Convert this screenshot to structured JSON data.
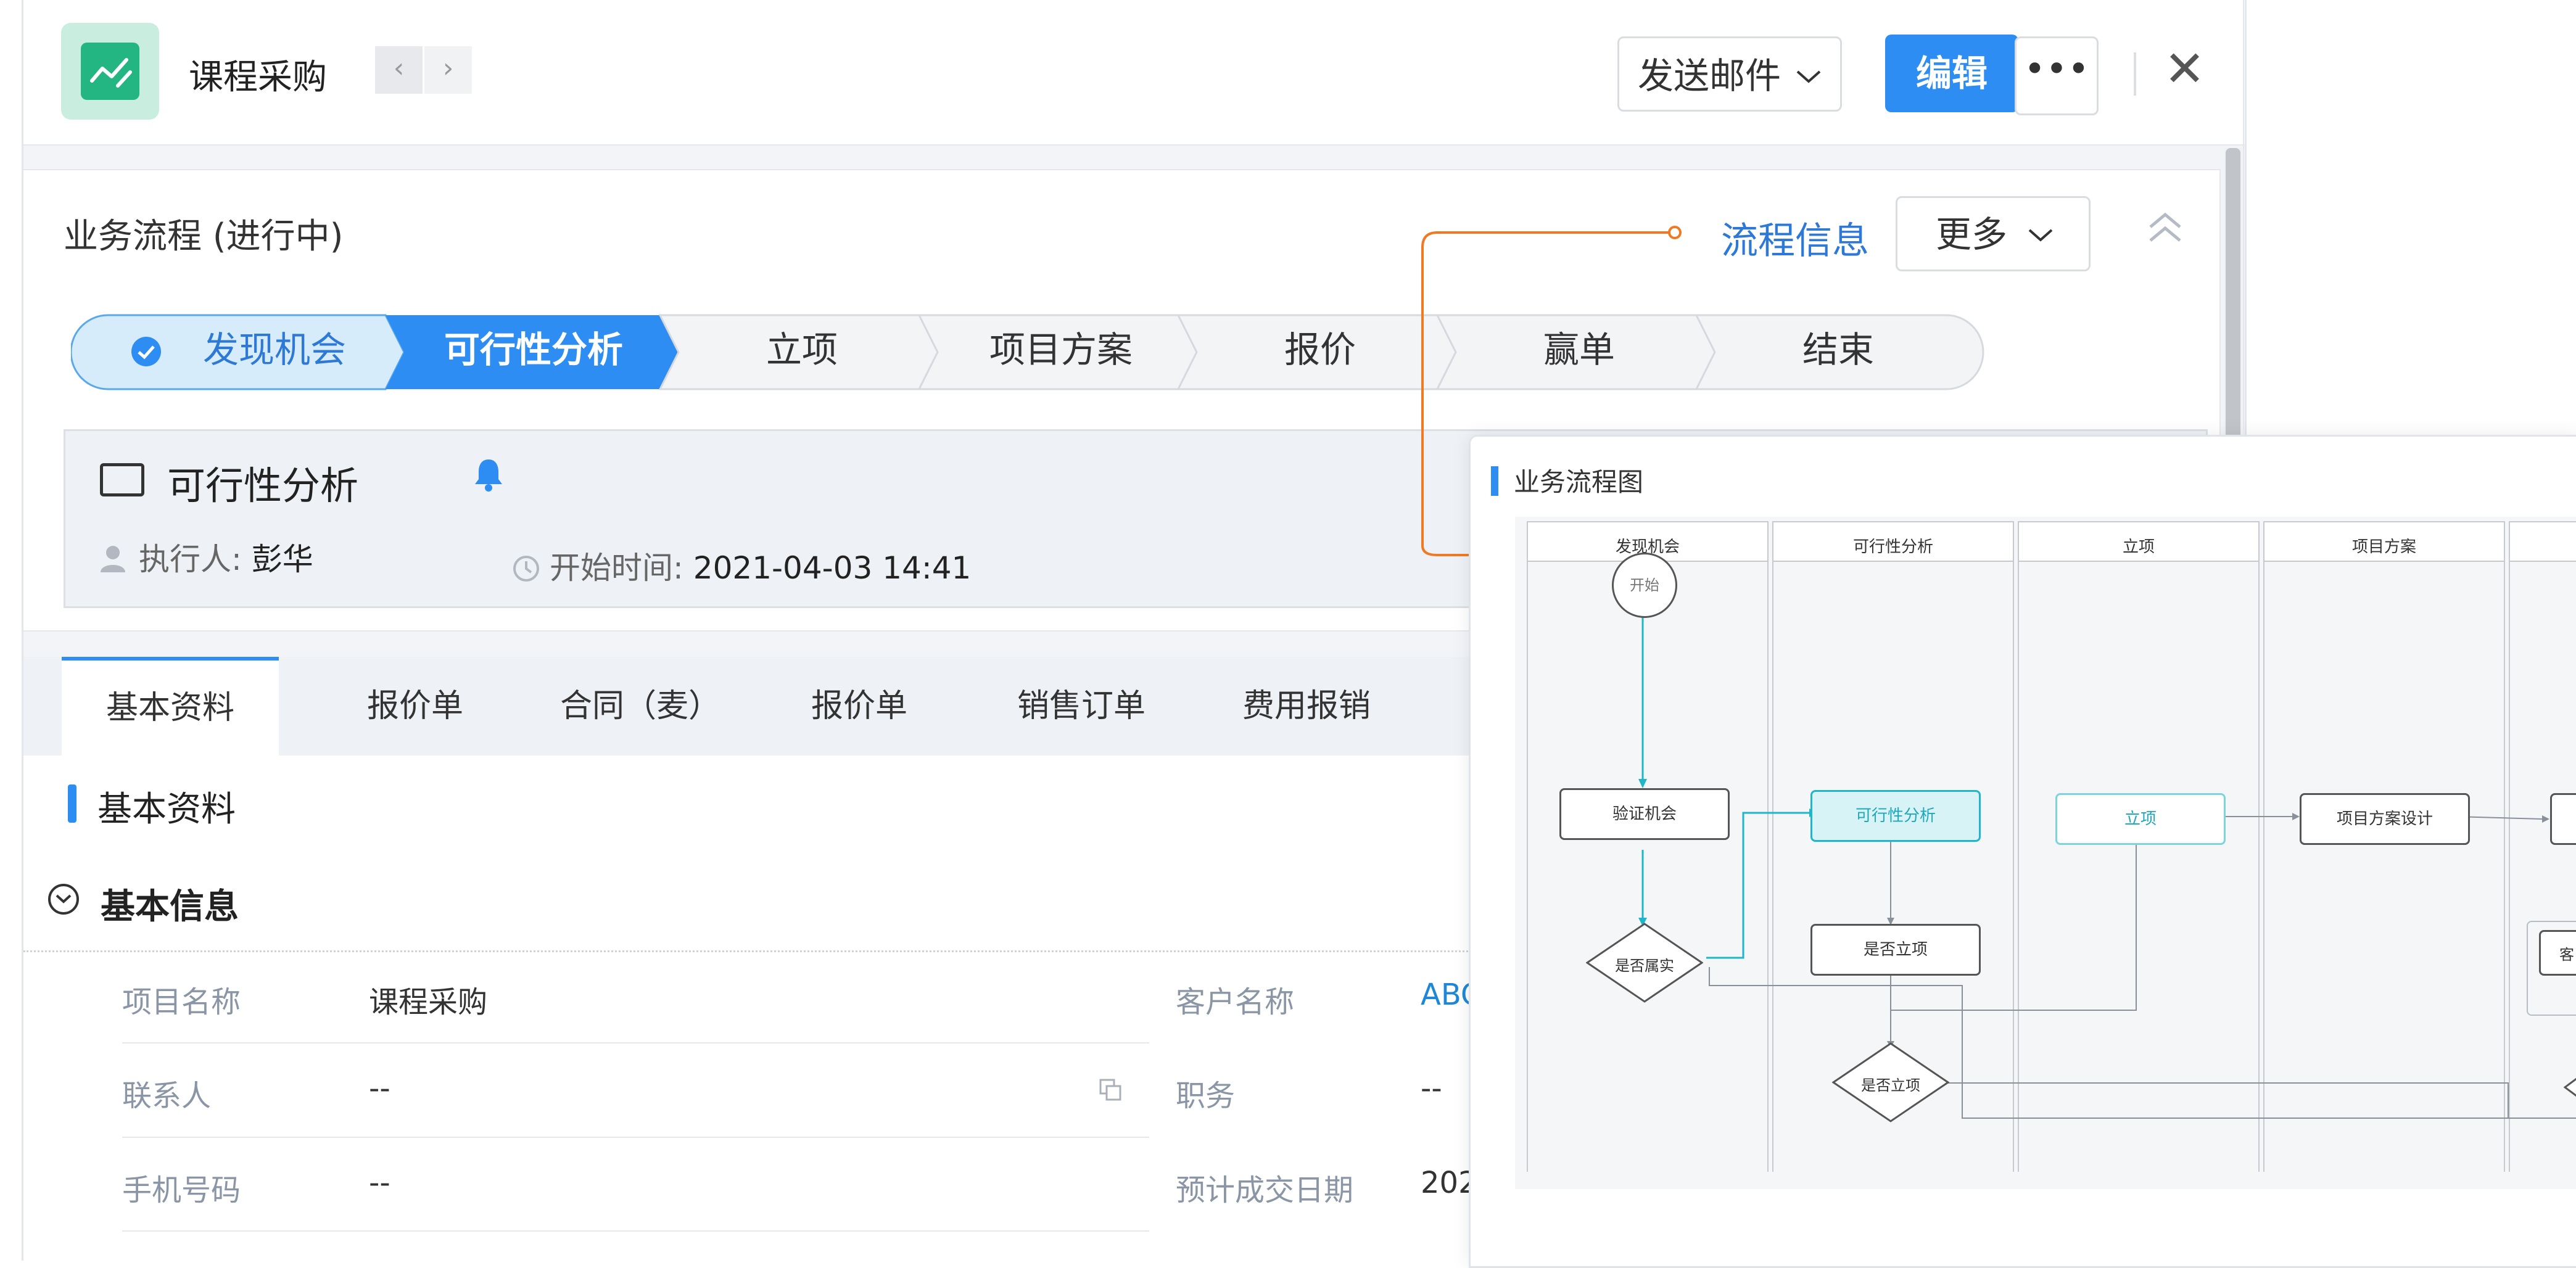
{
  "header": {
    "title": "课程采购",
    "prev_icon": "chevron-left-icon",
    "next_icon": "chevron-right-icon",
    "send_mail_label": "发送邮件",
    "edit_label": "编辑",
    "more_icon": "ellipsis-icon",
    "close_icon": "close-icon"
  },
  "process": {
    "title": "业务流程 (进行中)",
    "flow_info_label": "流程信息",
    "more_label": "更多",
    "stages": [
      {
        "label": "发现机会",
        "state": "done"
      },
      {
        "label": "可行性分析",
        "state": "active"
      },
      {
        "label": "立项",
        "state": "todo"
      },
      {
        "label": "项目方案",
        "state": "todo"
      },
      {
        "label": "报价",
        "state": "todo"
      },
      {
        "label": "赢单",
        "state": "todo"
      },
      {
        "label": "结束",
        "state": "todo"
      }
    ],
    "task": {
      "name": "可行性分析",
      "executor_label": "执行人:",
      "executor": "彭华",
      "start_label": "开始时间:",
      "start_time": "2021-04-03 14:41"
    }
  },
  "tabs": [
    "基本资料",
    "报价单",
    "合同（麦）",
    "报价单",
    "销售订单",
    "费用报销"
  ],
  "section": {
    "title": "基本资料",
    "group_title": "基本信息",
    "fields_left": [
      {
        "label": "项目名称",
        "value": "课程采购"
      },
      {
        "label": "联系人",
        "value": "--"
      },
      {
        "label": "手机号码",
        "value": "--"
      }
    ],
    "fields_right": [
      {
        "label": "客户名称",
        "value": "ABC"
      },
      {
        "label": "职务",
        "value": "--"
      },
      {
        "label": "预计成交日期",
        "value": "202"
      }
    ]
  },
  "flow_diagram": {
    "title": "业务流程图",
    "lanes": [
      "发现机会",
      "可行性分析",
      "立项",
      "项目方案"
    ],
    "nodes": {
      "start": "开始",
      "verify": "验证机会",
      "is_real": "是否属实",
      "feasibility": "可行性分析",
      "is_project1": "是否立项",
      "is_project2": "是否立项",
      "project": "立项",
      "design": "项目方案设计",
      "partial_right": "客"
    }
  },
  "colors": {
    "accent": "#2e8df3",
    "brand": "#23b582",
    "orange_link": "#f07a24",
    "cyan": "#1fb6c9"
  }
}
